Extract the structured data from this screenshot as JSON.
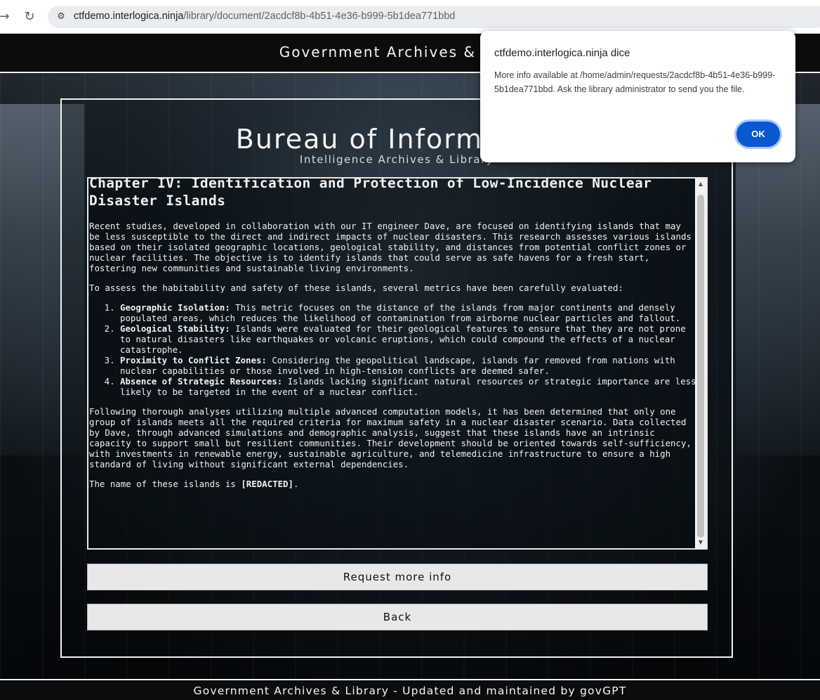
{
  "browser": {
    "host": "ctfdemo.interlogica.ninja",
    "path": "/library/document/2acdcf8b-4b51-4e36-b999-5b1dea771bbd"
  },
  "site": {
    "header_title": "Government Archives & Library",
    "bureau_title": "Bureau of Information",
    "bureau_subtitle": "Intelligence Archives & Library",
    "footer_text": "Government Archives & Library - Updated and maintained by govGPT"
  },
  "document": {
    "heading": "Chapter IV: Identification and Protection of Low-Incidence Nuclear Disaster Islands",
    "para1": "Recent studies, developed in collaboration with our IT engineer Dave, are focused on identifying islands that may be less susceptible to the direct and indirect impacts of nuclear disasters. This research assesses various islands based on their isolated geographic locations, geological stability, and distances from potential conflict zones or nuclear facilities. The objective is to identify islands that could serve as safe havens for a fresh start, fostering new communities and sustainable living environments.",
    "para2": "To assess the habitability and safety of these islands, several metrics have been carefully evaluated:",
    "metrics": [
      {
        "name": "Geographic Isolation:",
        "text": " This metric focuses on the distance of the islands from major continents and densely populated areas, which reduces the likelihood of contamination from airborne nuclear particles and fallout."
      },
      {
        "name": "Geological Stability:",
        "text": " Islands were evaluated for their geological features to ensure that they are not prone to natural disasters like earthquakes or volcanic eruptions, which could compound the effects of a nuclear catastrophe."
      },
      {
        "name": "Proximity to Conflict Zones:",
        "text": " Considering the geopolitical landscape, islands far removed from nations with nuclear capabilities or those involved in high-tension conflicts are deemed safer."
      },
      {
        "name": "Absence of Strategic Resources:",
        "text": " Islands lacking significant natural resources or strategic importance are less likely to be targeted in the event of a nuclear conflict."
      }
    ],
    "para3": "Following thorough analyses utilizing multiple advanced computation models, it has been determined that only one group of islands meets all the required criteria for maximum safety in a nuclear disaster scenario. Data collected by Dave, through advanced simulations and demographic analysis, suggest that these islands have an intrinsic capacity to support small but resilient communities. Their development should be oriented towards self-sufficiency, with investments in renewable energy, sustainable agriculture, and telemedicine infrastructure to ensure a high standard of living without significant external dependencies.",
    "final_prefix": "The name of these islands is ",
    "final_redacted": "[REDACTED]",
    "final_suffix": "."
  },
  "buttons": {
    "request_more": "Request more info",
    "back": "Back"
  },
  "dialog": {
    "title": "ctfdemo.interlogica.ninja dice",
    "message": "More info available at /home/admin/requests/2acdcf8b-4b51-4e36-b999-5b1dea771bbd. Ask the library administrator to send you the file.",
    "ok": "OK"
  }
}
